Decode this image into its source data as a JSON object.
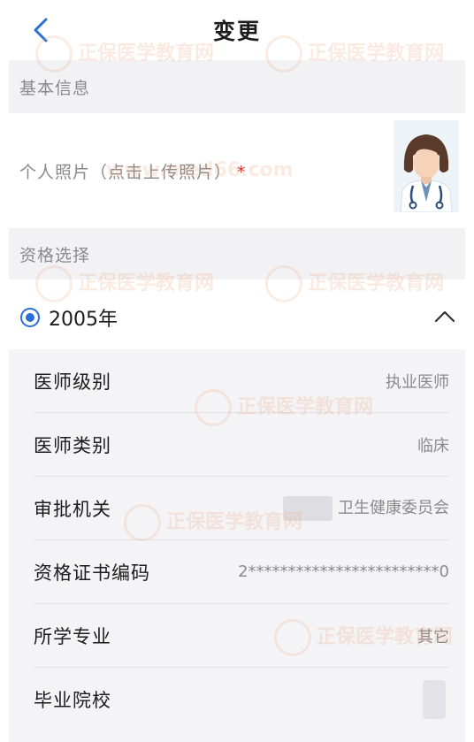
{
  "header": {
    "title": "变更",
    "back_icon": "chevron-left-icon"
  },
  "basic_info": {
    "section_title": "基本信息",
    "photo_label": "个人照片（点击上传照片）",
    "required_mark": "*"
  },
  "qualification": {
    "section_title": "资格选择",
    "year": "2005年",
    "selected": true,
    "expanded": true
  },
  "details": [
    {
      "label": "医师级别",
      "value": "执业医师"
    },
    {
      "label": "医师类别",
      "value": "临床"
    },
    {
      "label": "审批机关",
      "value": "卫生健康委员会"
    },
    {
      "label": "资格证书编码",
      "value": "2************************0"
    },
    {
      "label": "所学专业",
      "value": "其它"
    },
    {
      "label": "毕业院校",
      "value": ""
    }
  ],
  "watermark": {
    "brand": "正保",
    "text": "医学教育网",
    "url": "www.med66.com"
  },
  "colors": {
    "accent": "#2b6fd6",
    "required": "#d32f2f",
    "section_bg": "#f2f2f4"
  }
}
